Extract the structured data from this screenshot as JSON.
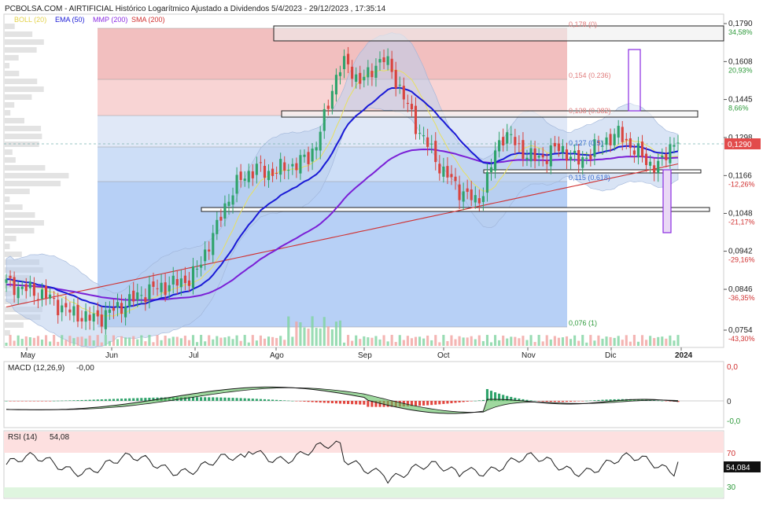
{
  "header": {
    "title": "PCBOLSA.COM - AIRTIFICIAL Histórico Logarítmico Ajustado a Dividendos 5/4/2023 - 29/12/2023 , 17:35:14",
    "legend": [
      {
        "label": "BOLL (20)",
        "color": "#e8e060"
      },
      {
        "label": "EMA (50)",
        "color": "#1a1ad6"
      },
      {
        "label": "MMP (200)",
        "color": "#8a2be2"
      },
      {
        "label": "SMA (200)",
        "color": "#d03030"
      }
    ]
  },
  "colors": {
    "bull": "#2fa36b",
    "bear": "#d9443f",
    "ema": "#1a1ad6",
    "mmp": "#7a1fd6",
    "sma": "#d03030",
    "boll": "#e8e060",
    "fib_red": "#f19b9b",
    "fib_blue": "#8fb3ef"
  },
  "price_axis": {
    "ticks": [
      {
        "price": "0,1790",
        "pct": "34,58%",
        "pct_color": "#2e9a3b"
      },
      {
        "price": "0,1608",
        "pct": "20,93%",
        "pct_color": "#2e9a3b"
      },
      {
        "price": "0,1445",
        "pct": "8,66%",
        "pct_color": "#2e9a3b"
      },
      {
        "price": "0,1298",
        "pct": "",
        "pct_color": "#2e9a3b"
      },
      {
        "price": "0,1166",
        "pct": "-12,26%",
        "pct_color": "#d03030"
      },
      {
        "price": "0,1048",
        "pct": "-21,17%",
        "pct_color": "#d03030"
      },
      {
        "price": "0,0942",
        "pct": "-29,16%",
        "pct_color": "#d03030"
      },
      {
        "price": "0,0846",
        "pct": "-36,35%",
        "pct_color": "#d03030"
      },
      {
        "price": "0,0754",
        "pct": "-43,30%",
        "pct_color": "#d03030"
      }
    ],
    "current_price": "0,1290"
  },
  "fib_labels": [
    "0,178 (0)",
    "0,154 (0.236)",
    "0,138 (0.382)",
    "0,127 (0.5)",
    "0,115 (0.618)",
    "0,076 (1)"
  ],
  "months": [
    "May",
    "Jun",
    "Jul",
    "Ago",
    "Sep",
    "Oct",
    "Nov",
    "Dic",
    "2024"
  ],
  "macd": {
    "label": "MACD (12,26,9)",
    "value": "-0,00",
    "ticks": [
      "0,0",
      "0",
      "-0,0"
    ]
  },
  "rsi": {
    "label": "RSI (14)",
    "value": "54,08",
    "last": "54,084",
    "ticks": [
      "70",
      "30"
    ]
  },
  "chart_data": {
    "type": "candlestick",
    "title": "PCBOLSA.COM - AIRTIFICIAL Histórico Logarítmico Ajustado a Dividendos 5/4/2023 - 29/12/2023 , 17:35:14",
    "scale": "log",
    "ylim": [
      0.0754,
      0.179
    ],
    "x": [
      "May",
      "Jun",
      "Jul",
      "Ago",
      "Sep",
      "Oct",
      "Nov",
      "Dic",
      "2024"
    ],
    "close_path": [
      0.086,
      0.0855,
      0.0848,
      0.0842,
      0.0838,
      0.0825,
      0.0812,
      0.08,
      0.079,
      0.0785,
      0.0778,
      0.0782,
      0.079,
      0.08,
      0.0812,
      0.082,
      0.0835,
      0.0842,
      0.085,
      0.0855,
      0.086,
      0.0866,
      0.0875,
      0.09,
      0.096,
      0.1,
      0.107,
      0.112,
      0.1155,
      0.118,
      0.119,
      0.1175,
      0.118,
      0.119,
      0.12,
      0.121,
      0.123,
      0.128,
      0.138,
      0.152,
      0.16,
      0.158,
      0.152,
      0.154,
      0.16,
      0.162,
      0.156,
      0.148,
      0.14,
      0.133,
      0.128,
      0.123,
      0.118,
      0.115,
      0.112,
      0.11,
      0.108,
      0.113,
      0.122,
      0.131,
      0.13,
      0.126,
      0.124,
      0.122,
      0.123,
      0.125,
      0.126,
      0.124,
      0.121,
      0.123,
      0.126,
      0.128,
      0.13,
      0.131,
      0.128,
      0.125,
      0.122,
      0.12,
      0.12,
      0.127,
      0.129
    ],
    "fibonacci": [
      {
        "level": 0,
        "price": 0.178
      },
      {
        "level": 0.236,
        "price": 0.154
      },
      {
        "level": 0.382,
        "price": 0.138
      },
      {
        "level": 0.5,
        "price": 0.127
      },
      {
        "level": 0.618,
        "price": 0.115
      },
      {
        "level": 1,
        "price": 0.076
      }
    ],
    "indicators": [
      "BOLL (20)",
      "EMA (50)",
      "MMP (200)",
      "SMA (200)"
    ],
    "last_close": 0.129,
    "macd_signal": -0.0,
    "rsi": {
      "last": 54.084,
      "upper": 70,
      "lower": 30
    }
  }
}
